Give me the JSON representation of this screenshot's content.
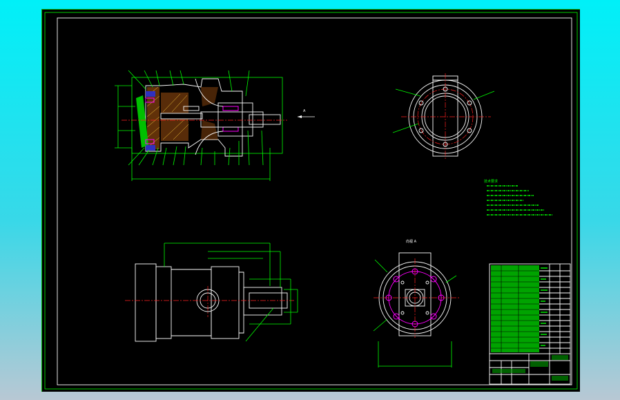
{
  "drawing": {
    "view_arrow_label": "A",
    "view_title": "向视 A",
    "notes_title": "技术要求",
    "notes_lines": [
      "",
      "",
      "",
      "",
      "",
      "",
      ""
    ],
    "titleblock": {
      "name_cell": "",
      "drawing_no": "",
      "company": ""
    }
  },
  "colors": {
    "sheet": "#000000",
    "line": "#00ff00",
    "outline": "#ffffff",
    "center": "#ff2020",
    "seal": "#ff00ff"
  }
}
